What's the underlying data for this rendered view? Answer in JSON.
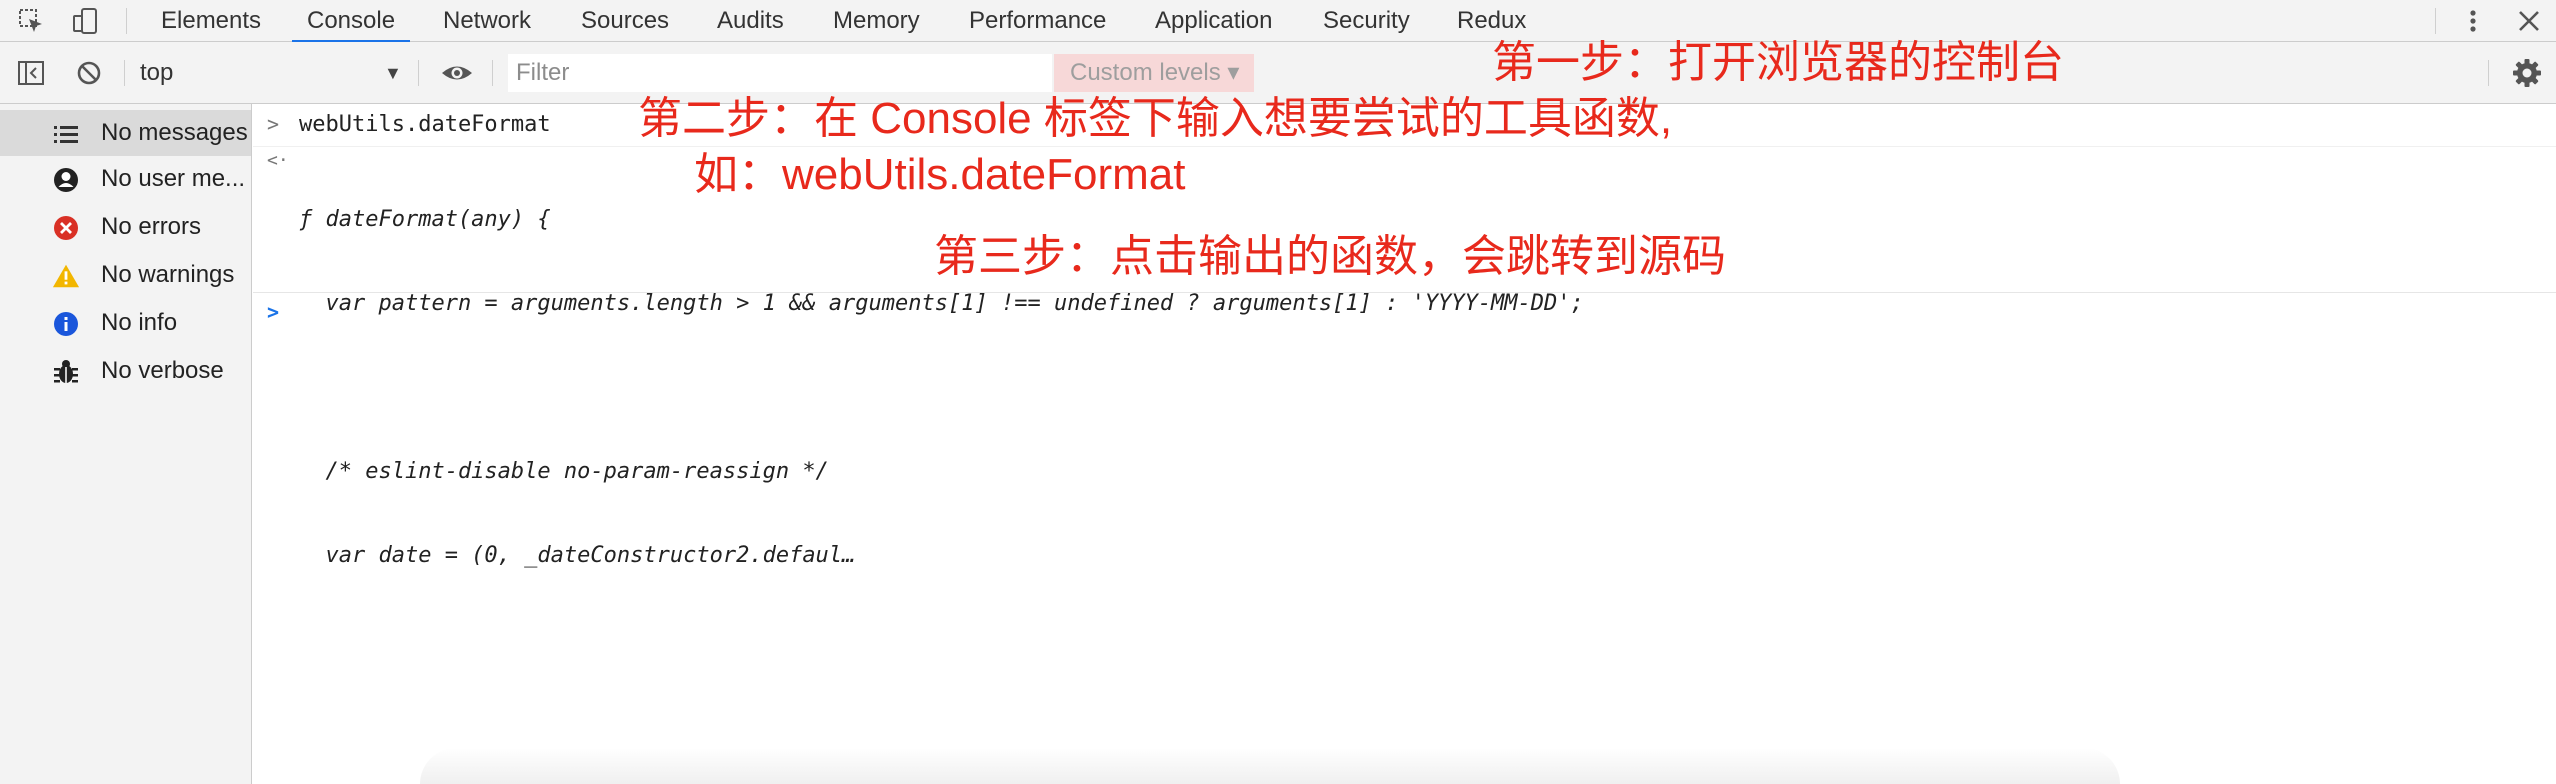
{
  "tabbar": {
    "tabs": [
      {
        "label": "Elements"
      },
      {
        "label": "Console",
        "active": true
      },
      {
        "label": "Network"
      },
      {
        "label": "Sources"
      },
      {
        "label": "Audits"
      },
      {
        "label": "Memory"
      },
      {
        "label": "Performance"
      },
      {
        "label": "Application"
      },
      {
        "label": "Security"
      },
      {
        "label": "Redux"
      }
    ],
    "accent_color": "#1a73e8"
  },
  "toolbar": {
    "context": "top",
    "filter_placeholder": "Filter",
    "filter_value": "",
    "levels_label": "Custom levels ▾"
  },
  "sidebar": {
    "items": [
      {
        "label": "No messages",
        "icon": "list-icon",
        "selected": true
      },
      {
        "label": "No user me...",
        "icon": "user-icon"
      },
      {
        "label": "No errors",
        "icon": "error-icon",
        "color": "#d93025"
      },
      {
        "label": "No warnings",
        "icon": "warning-icon",
        "color": "#f2b600"
      },
      {
        "label": "No info",
        "icon": "info-icon",
        "color": "#1a56db"
      },
      {
        "label": "No verbose",
        "icon": "bug-icon"
      }
    ]
  },
  "console": {
    "input_command": "webUtils.dateFormat",
    "output_lines": [
      "ƒ dateFormat(any) {",
      "  var pattern = arguments.length > 1 && arguments[1] !== undefined ? arguments[1] : 'YYYY-MM-DD';",
      "",
      "  /* eslint-disable no-param-reassign */",
      "  var date = (0, _dateConstructor2.defaul…"
    ]
  },
  "annotations": {
    "step1": "第一步：打开浏览器的控制台",
    "step2_line1": "第二步：在 Console 标签下输入想要尝试的工具函数,",
    "step2_line2": "如：webUtils.dateFormat",
    "step3": "第三步：点击输出的函数，会跳转到源码",
    "color": "#e8291c"
  }
}
